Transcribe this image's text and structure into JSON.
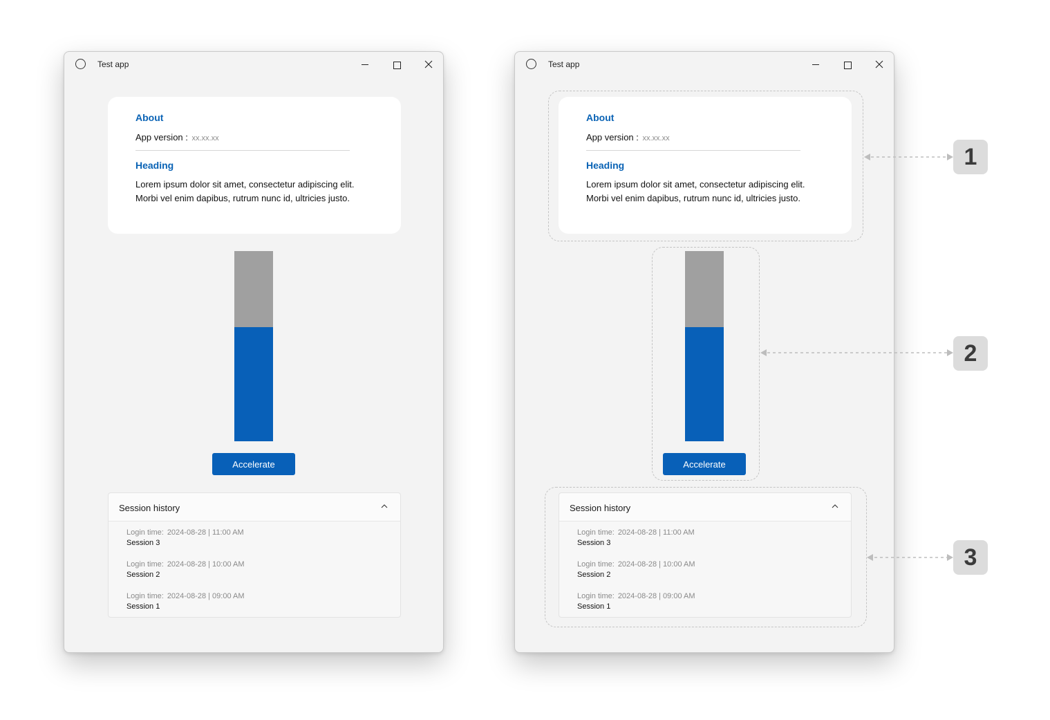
{
  "window": {
    "title": "Test app",
    "controls": [
      "minimize",
      "maximize",
      "close"
    ]
  },
  "about_card": {
    "title": "About",
    "version_label": "App version :",
    "version_value": "xx.xx.xx",
    "heading": "Heading",
    "body": "Lorem ipsum dolor sit amet, consectetur adipiscing elit. Morbi vel enim dapibus, rutrum nunc id, ultricies justo."
  },
  "gauge": {
    "fill_fraction": 0.6,
    "fill_color": "#0860b8",
    "track_color": "#a0a0a0"
  },
  "accelerate_button": {
    "label": "Accelerate"
  },
  "session_history": {
    "title": "Session history",
    "expanded": true,
    "entries": [
      {
        "login_label": "Login time:",
        "time": "2024-08-28 | 11:00 AM",
        "name": "Session 3"
      },
      {
        "login_label": "Login time:",
        "time": "2024-08-28 | 10:00 AM",
        "name": "Session 2"
      },
      {
        "login_label": "Login time:",
        "time": "2024-08-28 | 09:00 AM",
        "name": "Session 1"
      }
    ]
  },
  "annotations": {
    "labels": [
      "1",
      "2",
      "3"
    ],
    "color": "#c4c4c4",
    "badge_color": "#dcdcdc"
  }
}
